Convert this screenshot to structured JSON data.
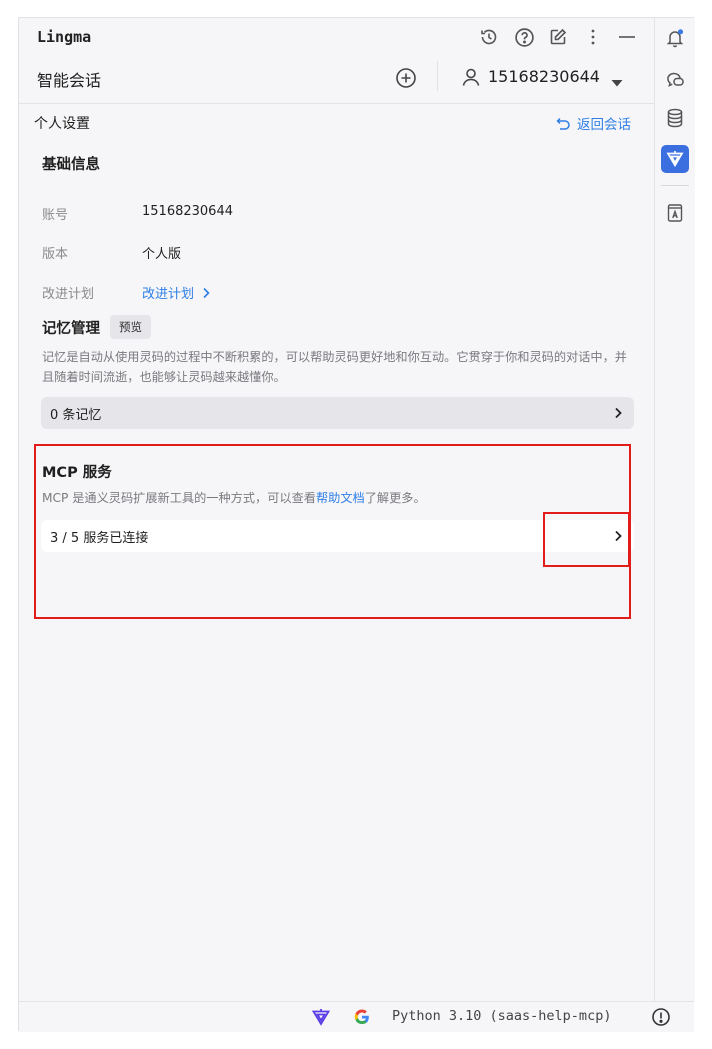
{
  "header": {
    "app_title": "Lingma",
    "conversation_title": "智能会话",
    "user_id": "15168230644"
  },
  "page": {
    "title": "个人设置",
    "back_label": "返回会话"
  },
  "basic_info": {
    "title": "基础信息",
    "rows": [
      {
        "label": "账号",
        "value": "15168230644"
      },
      {
        "label": "版本",
        "value": "个人版"
      },
      {
        "label": "改进计划",
        "value": "改进计划"
      }
    ]
  },
  "memory": {
    "title": "记忆管理",
    "badge": "预览",
    "description": "记忆是自动从使用灵码的过程中不断积累的，可以帮助灵码更好地和你互动。它贯穿于你和灵码的对话中，并且随着时间流逝，也能够让灵码越来越懂你。",
    "count_label": "0 条记忆"
  },
  "mcp": {
    "title": "MCP 服务",
    "description_prefix": "MCP 是通义灵码扩展新工具的一种方式，可以查看",
    "help_link": "帮助文档",
    "description_suffix": "了解更多。",
    "status_label": "3 / 5 服务已连接"
  },
  "statusbar": {
    "interpreter": "Python 3.10 (saas-help-mcp)"
  },
  "colors": {
    "accent": "#2f7fe6",
    "highlight_box": "#e21b1b",
    "sidebar_active": "#3b6fe0"
  }
}
